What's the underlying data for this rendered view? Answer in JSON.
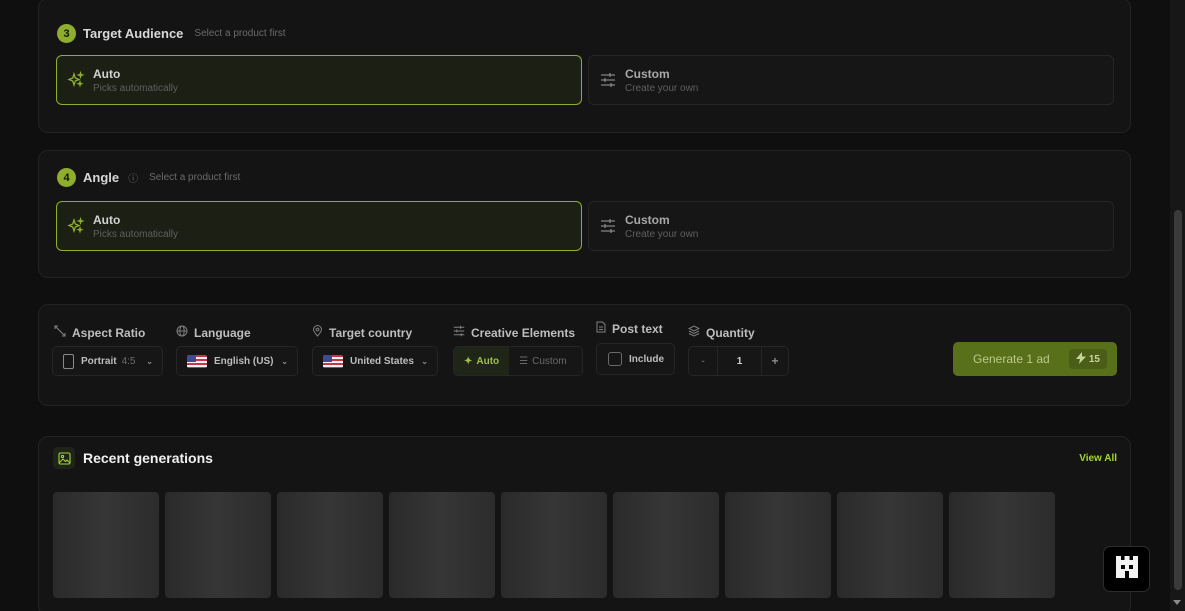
{
  "steps": [
    {
      "number": "3",
      "title": "Target Audience",
      "hint": "Select a product first",
      "options": [
        {
          "title": "Auto",
          "subtitle": "Picks automatically",
          "selected": true
        },
        {
          "title": "Custom",
          "subtitle": "Create your own",
          "selected": false
        }
      ]
    },
    {
      "number": "4",
      "title": "Angle",
      "hint": "Select a product first",
      "options": [
        {
          "title": "Auto",
          "subtitle": "Picks automatically",
          "selected": true
        },
        {
          "title": "Custom",
          "subtitle": "Create your own",
          "selected": false
        }
      ]
    }
  ],
  "controls": {
    "aspect_ratio": {
      "label": "Aspect Ratio",
      "value": "Portrait",
      "ratio": "4:5"
    },
    "language": {
      "label": "Language",
      "value": "English (US)"
    },
    "target_country": {
      "label": "Target country",
      "value": "United States"
    },
    "creative_elements": {
      "label": "Creative Elements",
      "auto": "Auto",
      "custom": "Custom",
      "selected": "Auto"
    },
    "post_text": {
      "label": "Post text",
      "checkbox_label": "Include",
      "checked": false
    },
    "quantity": {
      "label": "Quantity",
      "minus": "-",
      "value": "1",
      "plus": "+"
    },
    "generate": {
      "label": "Generate 1 ad",
      "cost": "15"
    }
  },
  "recent": {
    "title": "Recent generations",
    "view_all": "View All",
    "thumbnail_count": 9
  },
  "colors": {
    "accent": "#8fae2d",
    "button": "#59701a",
    "link": "#a3d533",
    "background": "#0f0f0f"
  }
}
